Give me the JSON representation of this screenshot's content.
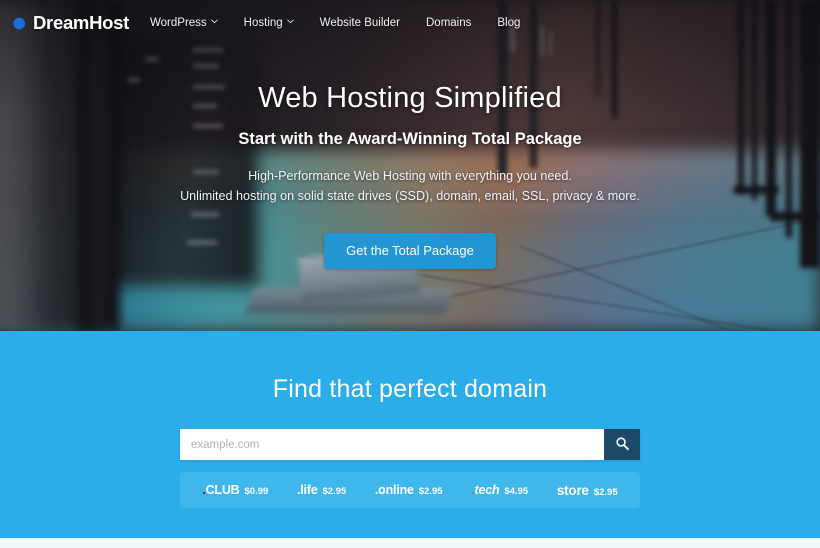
{
  "brand": {
    "name": "DreamHost",
    "logo_icon": "crescent-moon-icon",
    "logo_color": "#1a6fd4"
  },
  "header": {
    "nav": [
      {
        "label": "WordPress",
        "has_dropdown": true,
        "icon": "chevron-down-icon"
      },
      {
        "label": "Hosting",
        "has_dropdown": true,
        "icon": "chevron-down-icon"
      },
      {
        "label": "Website Builder",
        "has_dropdown": false
      },
      {
        "label": "Domains",
        "has_dropdown": false
      },
      {
        "label": "Blog",
        "has_dropdown": false
      }
    ]
  },
  "hero": {
    "heading": "Web Hosting Simplified",
    "subheading": "Start with the Award-Winning Total Package",
    "body_line1": "High-Performance Web Hosting with everything you need.",
    "body_line2": "Unlimited hosting on solid state drives (SSD), domain, email, SSL, privacy & more.",
    "cta_label": "Get the Total Package",
    "cta_color": "#2196d3",
    "background_description": "blurred data center server room with rainbow floor reflection"
  },
  "domain_section": {
    "title": "Find that perfect domain",
    "background_color": "#2badea",
    "search": {
      "placeholder": "example.com",
      "value": "",
      "button_icon": "search-icon",
      "button_color": "#1c4a67"
    },
    "tlds": [
      {
        "name": ".CLUB",
        "price": "$0.99",
        "dot_color": "#8c1a1a",
        "italic": false
      },
      {
        "name": ".life",
        "price": "$2.95",
        "dot_color": "#ffffff",
        "italic": false
      },
      {
        "name": ".online",
        "price": "$2.95",
        "dot_color": "#ffffff",
        "italic": false
      },
      {
        "name": ".tech",
        "price": "$4.95",
        "dot_color": "#3fae3f",
        "italic": true
      },
      {
        "name": "store",
        "price": "$2.95",
        "dot_color": "#ffffff",
        "italic": false
      }
    ]
  }
}
